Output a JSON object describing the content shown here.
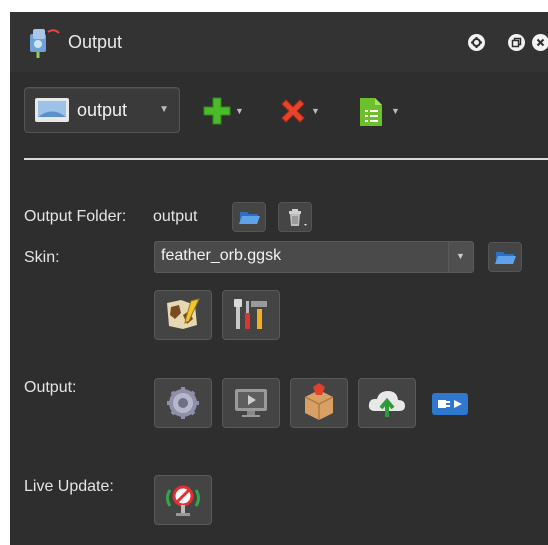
{
  "titlebar": {
    "title": "Output",
    "icons": [
      "app-icon",
      "help-icon",
      "float-icon",
      "close-icon"
    ]
  },
  "toolbar": {
    "output_select_value": "output",
    "icons": [
      "output-screen-icon",
      "add-icon",
      "delete-icon",
      "document-icon"
    ]
  },
  "form": {
    "output_folder_label": "Output Folder:",
    "output_folder_value": "output",
    "skin_label": "Skin:",
    "skin_value": "feather_orb.ggsk",
    "output_label": "Output:",
    "live_update_label": "Live Update:"
  },
  "colors": {
    "panel_bg": "#2e2e2e",
    "add_green": "#4cbb2a",
    "delete_red": "#e8442a",
    "doc_green": "#6cc02a",
    "folder_blue": "#3b82d8"
  }
}
